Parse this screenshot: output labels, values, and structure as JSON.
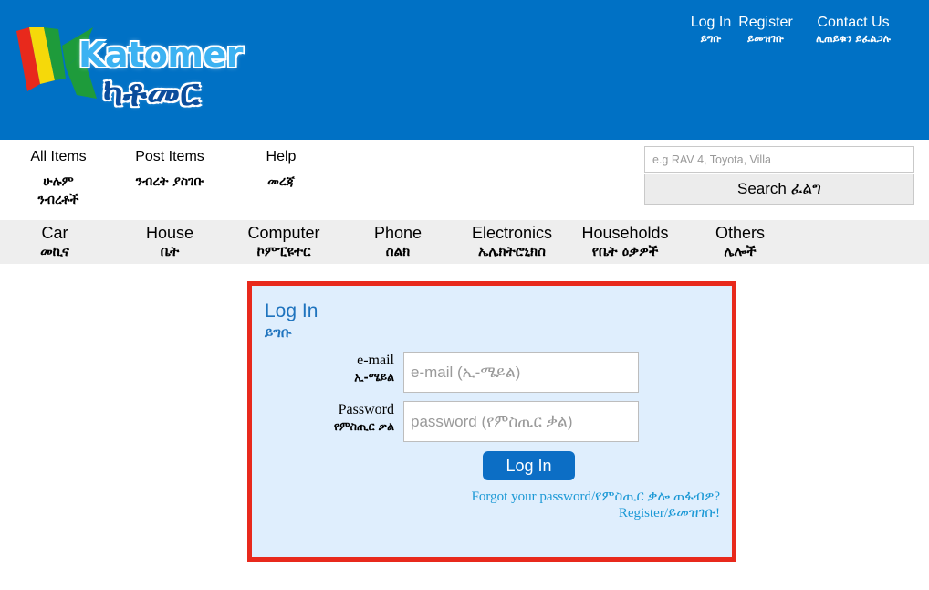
{
  "header": {
    "logo": {
      "wordmark": "Katomer",
      "wordmark_ethiopic": "ካቶመር",
      "flag_colors": [
        "#e8291c",
        "#f5d90a",
        "#1e9b3b"
      ]
    },
    "top_links": {
      "login": {
        "en": "Log In",
        "am": "ይግቡ"
      },
      "register": {
        "en": "Register",
        "am": "ይመዝገቡ"
      },
      "contact": {
        "en": "Contact Us",
        "am": "ሊጠይቁን ይፈልጋሉ"
      }
    },
    "background_color": "#0071c5"
  },
  "main_nav": {
    "all_items": {
      "en": "All Items",
      "am": "ሁሉም ንብረቶች"
    },
    "post_items": {
      "en": "Post Items",
      "am": "ንብረት ያስገቡ"
    },
    "help": {
      "en": "Help",
      "am": "መረጃ"
    }
  },
  "search": {
    "placeholder": "e.g RAV 4, Toyota, Villa",
    "value": "",
    "button_label": "Search ፈልግ"
  },
  "categories": {
    "car": {
      "en": "Car",
      "am": "መኪና"
    },
    "house": {
      "en": "House",
      "am": "ቤት"
    },
    "computer": {
      "en": "Computer",
      "am": "ኮምፒዩተር"
    },
    "phone": {
      "en": "Phone",
      "am": "ስልክ"
    },
    "electronics": {
      "en": "Electronics",
      "am": "ኤሌክትሮኒክስ"
    },
    "households": {
      "en": "Households",
      "am": "የቤት ዕቃዎች"
    },
    "others": {
      "en": "Others",
      "am": "ሌሎች"
    }
  },
  "login_panel": {
    "title": {
      "en": "Log In",
      "am": "ይግቡ"
    },
    "email": {
      "label_en": "e-mail",
      "label_am": "ኢ-ሜይል",
      "placeholder": "e-mail (ኢ-ሜይል)",
      "value": ""
    },
    "password": {
      "label_en": "Password",
      "label_am": "የምስጢር ቃል",
      "placeholder": "password (የምስጢር ቃል)",
      "value": ""
    },
    "submit_label": "Log In",
    "forgot_link": "Forgot your password/የምስጢር ቃሎ ጠፋብዎ?",
    "register_link": "Register/ይመዝገቡ!",
    "border_color": "#e8291c",
    "background_color": "#dfeefd"
  }
}
